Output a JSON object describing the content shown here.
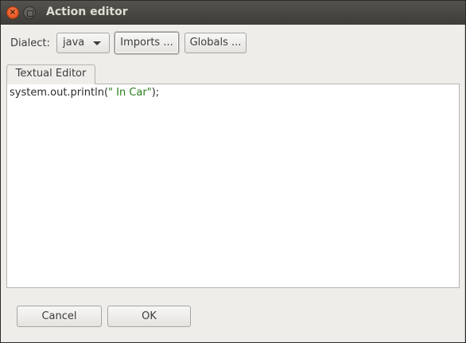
{
  "window": {
    "title": "Action editor"
  },
  "toolbar": {
    "dialect_label": "Dialect:",
    "dialect_value": "java",
    "imports_label": "Imports ...",
    "globals_label": "Globals ..."
  },
  "tabs": [
    {
      "label": "Textual Editor"
    }
  ],
  "editor": {
    "code_prefix": "system.out.println(",
    "code_string": "\" In Car\"",
    "code_suffix": ");"
  },
  "actions": {
    "cancel_label": "Cancel",
    "ok_label": "OK"
  },
  "colors": {
    "close_button": "#dd4814",
    "string_literal": "#2a7d19",
    "titlebar": "#3d3c38"
  }
}
